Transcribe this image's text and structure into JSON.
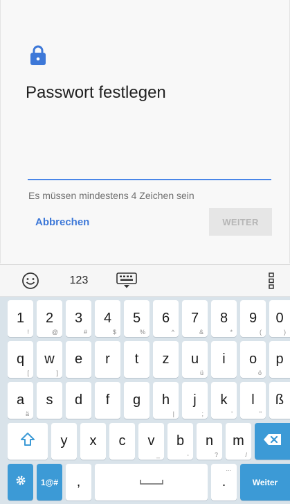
{
  "dialog": {
    "title": "Passwort festlegen",
    "hint": "Es müssen mindestens 4 Zeichen sein",
    "cancel_label": "Abbrechen",
    "next_label": "WEITER",
    "password_value": ""
  },
  "colors": {
    "accent": "#3d78d8",
    "keyboard_blue": "#3c9ad6",
    "keyboard_bg": "#d9e3ea"
  },
  "keyboard_toolbar": {
    "emoji_icon": "smiley-icon",
    "numbers_label": "123",
    "keyboard_icon": "keyboard-hide-icon",
    "menu_icon": "more-vertical-icon"
  },
  "keyboard": {
    "row1": [
      {
        "main": "1",
        "sub": "!"
      },
      {
        "main": "2",
        "sub": "@"
      },
      {
        "main": "3",
        "sub": "#"
      },
      {
        "main": "4",
        "sub": "$"
      },
      {
        "main": "5",
        "sub": "%"
      },
      {
        "main": "6",
        "sub": "^"
      },
      {
        "main": "7",
        "sub": "&"
      },
      {
        "main": "8",
        "sub": "*"
      },
      {
        "main": "9",
        "sub": "("
      },
      {
        "main": "0",
        "sub": ")"
      }
    ],
    "row2": [
      {
        "main": "q",
        "sub": "["
      },
      {
        "main": "w",
        "sub": "]"
      },
      {
        "main": "e",
        "sub": ""
      },
      {
        "main": "r",
        "sub": ""
      },
      {
        "main": "t",
        "sub": ""
      },
      {
        "main": "z",
        "sub": ""
      },
      {
        "main": "u",
        "sub": "ü"
      },
      {
        "main": "i",
        "sub": ""
      },
      {
        "main": "o",
        "sub": "ö"
      },
      {
        "main": "p",
        "sub": ""
      }
    ],
    "row3": [
      {
        "main": "a",
        "sub": "ä"
      },
      {
        "main": "s",
        "sub": ""
      },
      {
        "main": "d",
        "sub": ""
      },
      {
        "main": "f",
        "sub": ""
      },
      {
        "main": "g",
        "sub": ""
      },
      {
        "main": "h",
        "sub": "|"
      },
      {
        "main": "j",
        "sub": ";"
      },
      {
        "main": "k",
        "sub": "'"
      },
      {
        "main": "l",
        "sub": "\""
      },
      {
        "main": "ß",
        "sub": ""
      }
    ],
    "row4": [
      {
        "main": "y",
        "sub": ""
      },
      {
        "main": "x",
        "sub": ""
      },
      {
        "main": "c",
        "sub": ""
      },
      {
        "main": "v",
        "sub": "_"
      },
      {
        "main": "b",
        "sub": "-"
      },
      {
        "main": "n",
        "sub": "?"
      },
      {
        "main": "m",
        "sub": "/"
      }
    ],
    "sym_label": "1@#",
    "comma_label": ",",
    "period_label": ".",
    "period_sub": "...",
    "enter_label": "Weiter",
    "shift_icon": "shift-arrow-icon",
    "backspace_icon": "backspace-icon",
    "settings_icon": "gear-icon",
    "space_icon": "space-bar-icon"
  }
}
